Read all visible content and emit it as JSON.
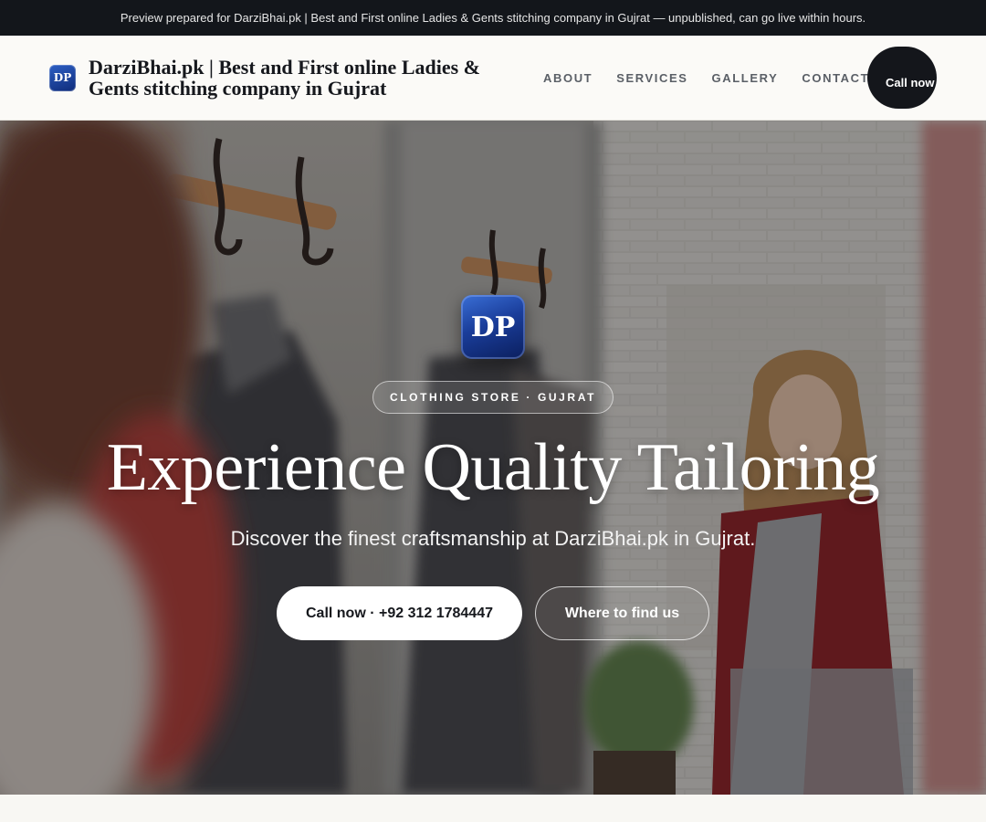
{
  "preview_bar": {
    "text": "Preview prepared for DarziBhai.pk | Best and First online Ladies & Gents stitching company in Gujrat — unpublished, can go live within hours."
  },
  "header": {
    "logo_text": "DP",
    "brand_name": "DarziBhai.pk | Best and First online Ladies & Gents stitching company in Gujrat",
    "nav": [
      "ABOUT",
      "SERVICES",
      "GALLERY",
      "CONTACT"
    ],
    "call_button": "Call now"
  },
  "hero": {
    "logo_text": "DP",
    "badge": "CLOTHING STORE · GUJRAT",
    "title": "Experience Quality Tailoring",
    "subtitle": "Discover the finest craftsmanship at DarziBhai.pk in Gujrat.",
    "primary_button": "Call now · +92 312 1784447",
    "secondary_button": "Where to find us"
  },
  "colors": {
    "top_bar_bg": "#13161b",
    "header_bg": "#fbfaf7",
    "call_button_bg": "#14161b",
    "logo_blue": "#1a3d9a",
    "hero_overlay": "#121216"
  }
}
